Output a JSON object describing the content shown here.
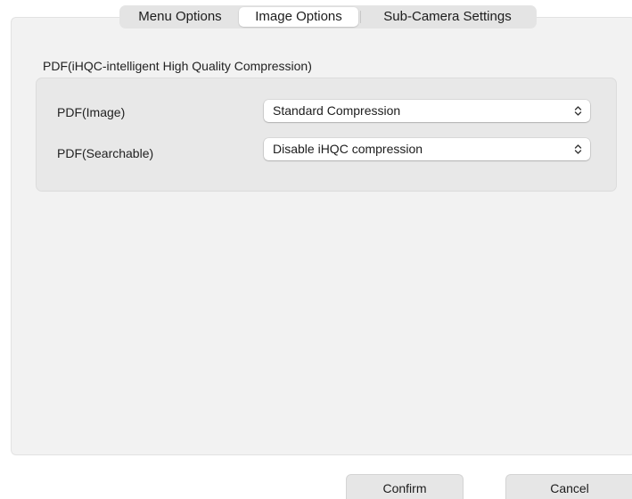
{
  "tabs": [
    {
      "label": "Menu Options",
      "selected": false
    },
    {
      "label": "Image Options",
      "selected": true
    },
    {
      "label": "Sub-Camera Settings",
      "selected": false
    }
  ],
  "group": {
    "title": "PDF(iHQC-intelligent High Quality Compression)",
    "rows": [
      {
        "label": "PDF(Image)",
        "value": "Standard Compression"
      },
      {
        "label": "PDF(Searchable)",
        "value": "Disable iHQC compression"
      }
    ]
  },
  "buttons": {
    "confirm_label": "Confirm",
    "cancel_label": "Cancel"
  },
  "icons": {
    "select_chevron": "chevron-up-down-icon"
  }
}
